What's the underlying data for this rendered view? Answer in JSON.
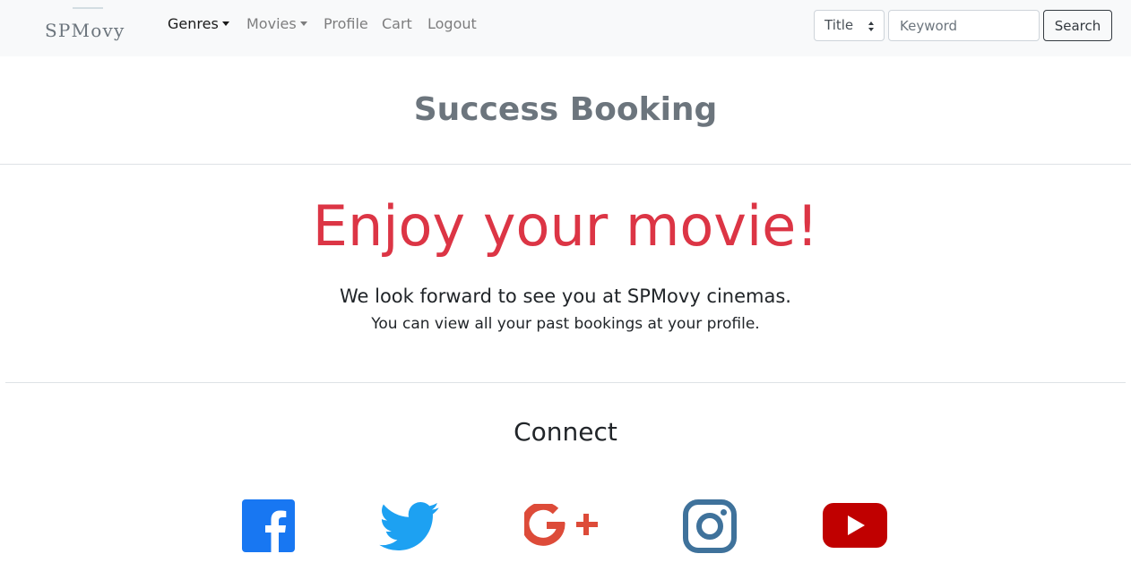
{
  "navbar": {
    "brand": "SPMovy",
    "links": [
      {
        "label": "Genres",
        "dropdown": true,
        "active": true
      },
      {
        "label": "Movies",
        "dropdown": true,
        "active": false
      },
      {
        "label": "Profile",
        "dropdown": false,
        "active": false
      },
      {
        "label": "Cart",
        "dropdown": false,
        "active": false
      },
      {
        "label": "Logout",
        "dropdown": false,
        "active": false
      }
    ],
    "search": {
      "field_select_value": "Title",
      "keyword_placeholder": "Keyword",
      "keyword_value": "",
      "button_label": "Search"
    }
  },
  "page": {
    "title": "Success Booking",
    "headline": "Enjoy your movie!",
    "message_line1": "We look forward to see you at SPMovy cinemas.",
    "message_line2": "You can view all your past bookings at your profile."
  },
  "footer": {
    "heading": "Connect",
    "social": [
      {
        "icon": "facebook-icon",
        "color": "#1877f2"
      },
      {
        "icon": "twitter-icon",
        "color": "#1da1f2"
      },
      {
        "icon": "google-plus-icon",
        "color": "#dd4b39"
      },
      {
        "icon": "instagram-icon",
        "color": "#3f729b"
      },
      {
        "icon": "youtube-icon",
        "color": "#c4302b"
      }
    ]
  },
  "colors": {
    "navbar_bg": "#f8f9fa",
    "headline": "#dc3545",
    "title": "#6c757d"
  }
}
